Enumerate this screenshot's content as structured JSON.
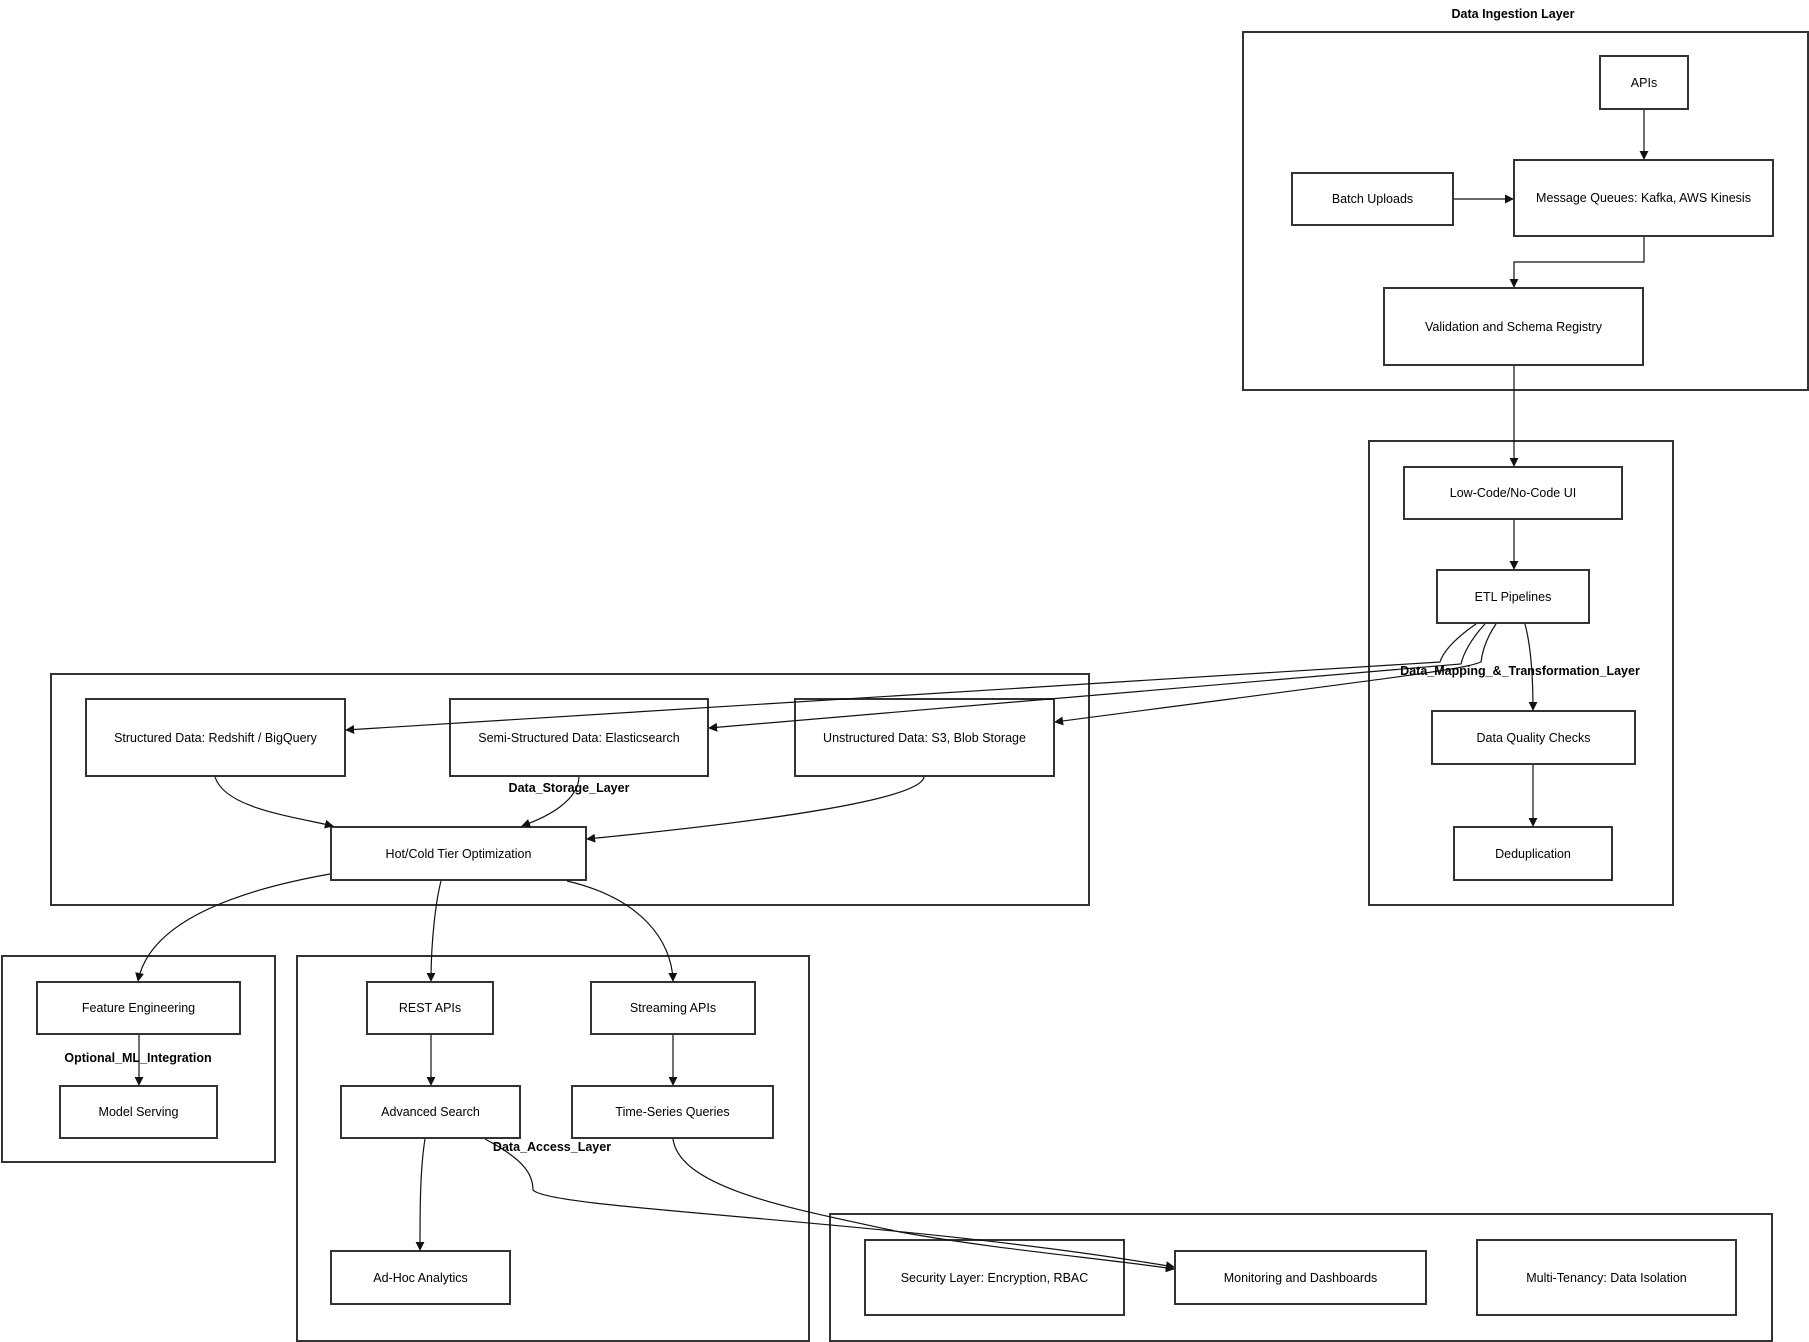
{
  "diagram": {
    "clusters": {
      "ingestion": "Data Ingestion Layer",
      "mapping": "Data_Mapping_&_Transformation_Layer",
      "storage": "Data_Storage_Layer",
      "ml": "Optional_ML_Integration",
      "access": "Data_Access_Layer",
      "crosscutting": ""
    },
    "nodes": {
      "apis": "APIs",
      "batch_uploads": "Batch Uploads",
      "message_queues": "Message Queues: Kafka, AWS Kinesis",
      "validation": "Validation and Schema Registry",
      "low_code": "Low-Code/No-Code UI",
      "etl": "ETL Pipelines",
      "data_quality": "Data Quality Checks",
      "dedup": "Deduplication",
      "structured": "Structured Data: Redshift / BigQuery",
      "semi_structured": "Semi-Structured Data: Elasticsearch",
      "unstructured": "Unstructured Data: S3, Blob Storage",
      "hot_cold": "Hot/Cold Tier Optimization",
      "feature_eng": "Feature Engineering",
      "model_serving": "Model Serving",
      "rest_apis": "REST APIs",
      "streaming_apis": "Streaming APIs",
      "advanced_search": "Advanced Search",
      "time_series": "Time-Series Queries",
      "adhoc": "Ad-Hoc Analytics",
      "security": "Security Layer: Encryption, RBAC",
      "monitoring": "Monitoring and Dashboards",
      "multi_tenancy": "Multi-Tenancy: Data Isolation"
    },
    "edges": [
      {
        "from": "apis",
        "to": "message_queues"
      },
      {
        "from": "batch_uploads",
        "to": "message_queues"
      },
      {
        "from": "message_queues",
        "to": "validation"
      },
      {
        "from": "validation",
        "to": "low_code"
      },
      {
        "from": "low_code",
        "to": "etl"
      },
      {
        "from": "etl",
        "to": "structured"
      },
      {
        "from": "etl",
        "to": "semi_structured"
      },
      {
        "from": "etl",
        "to": "unstructured"
      },
      {
        "from": "etl",
        "to": "data_quality"
      },
      {
        "from": "data_quality",
        "to": "dedup"
      },
      {
        "from": "structured",
        "to": "hot_cold"
      },
      {
        "from": "semi_structured",
        "to": "hot_cold"
      },
      {
        "from": "unstructured",
        "to": "hot_cold"
      },
      {
        "from": "hot_cold",
        "to": "feature_eng"
      },
      {
        "from": "hot_cold",
        "to": "rest_apis"
      },
      {
        "from": "hot_cold",
        "to": "streaming_apis"
      },
      {
        "from": "feature_eng",
        "to": "model_serving"
      },
      {
        "from": "rest_apis",
        "to": "advanced_search"
      },
      {
        "from": "streaming_apis",
        "to": "time_series"
      },
      {
        "from": "advanced_search",
        "to": "adhoc"
      },
      {
        "from": "advanced_search",
        "to": "monitoring"
      },
      {
        "from": "time_series",
        "to": "monitoring"
      }
    ]
  }
}
